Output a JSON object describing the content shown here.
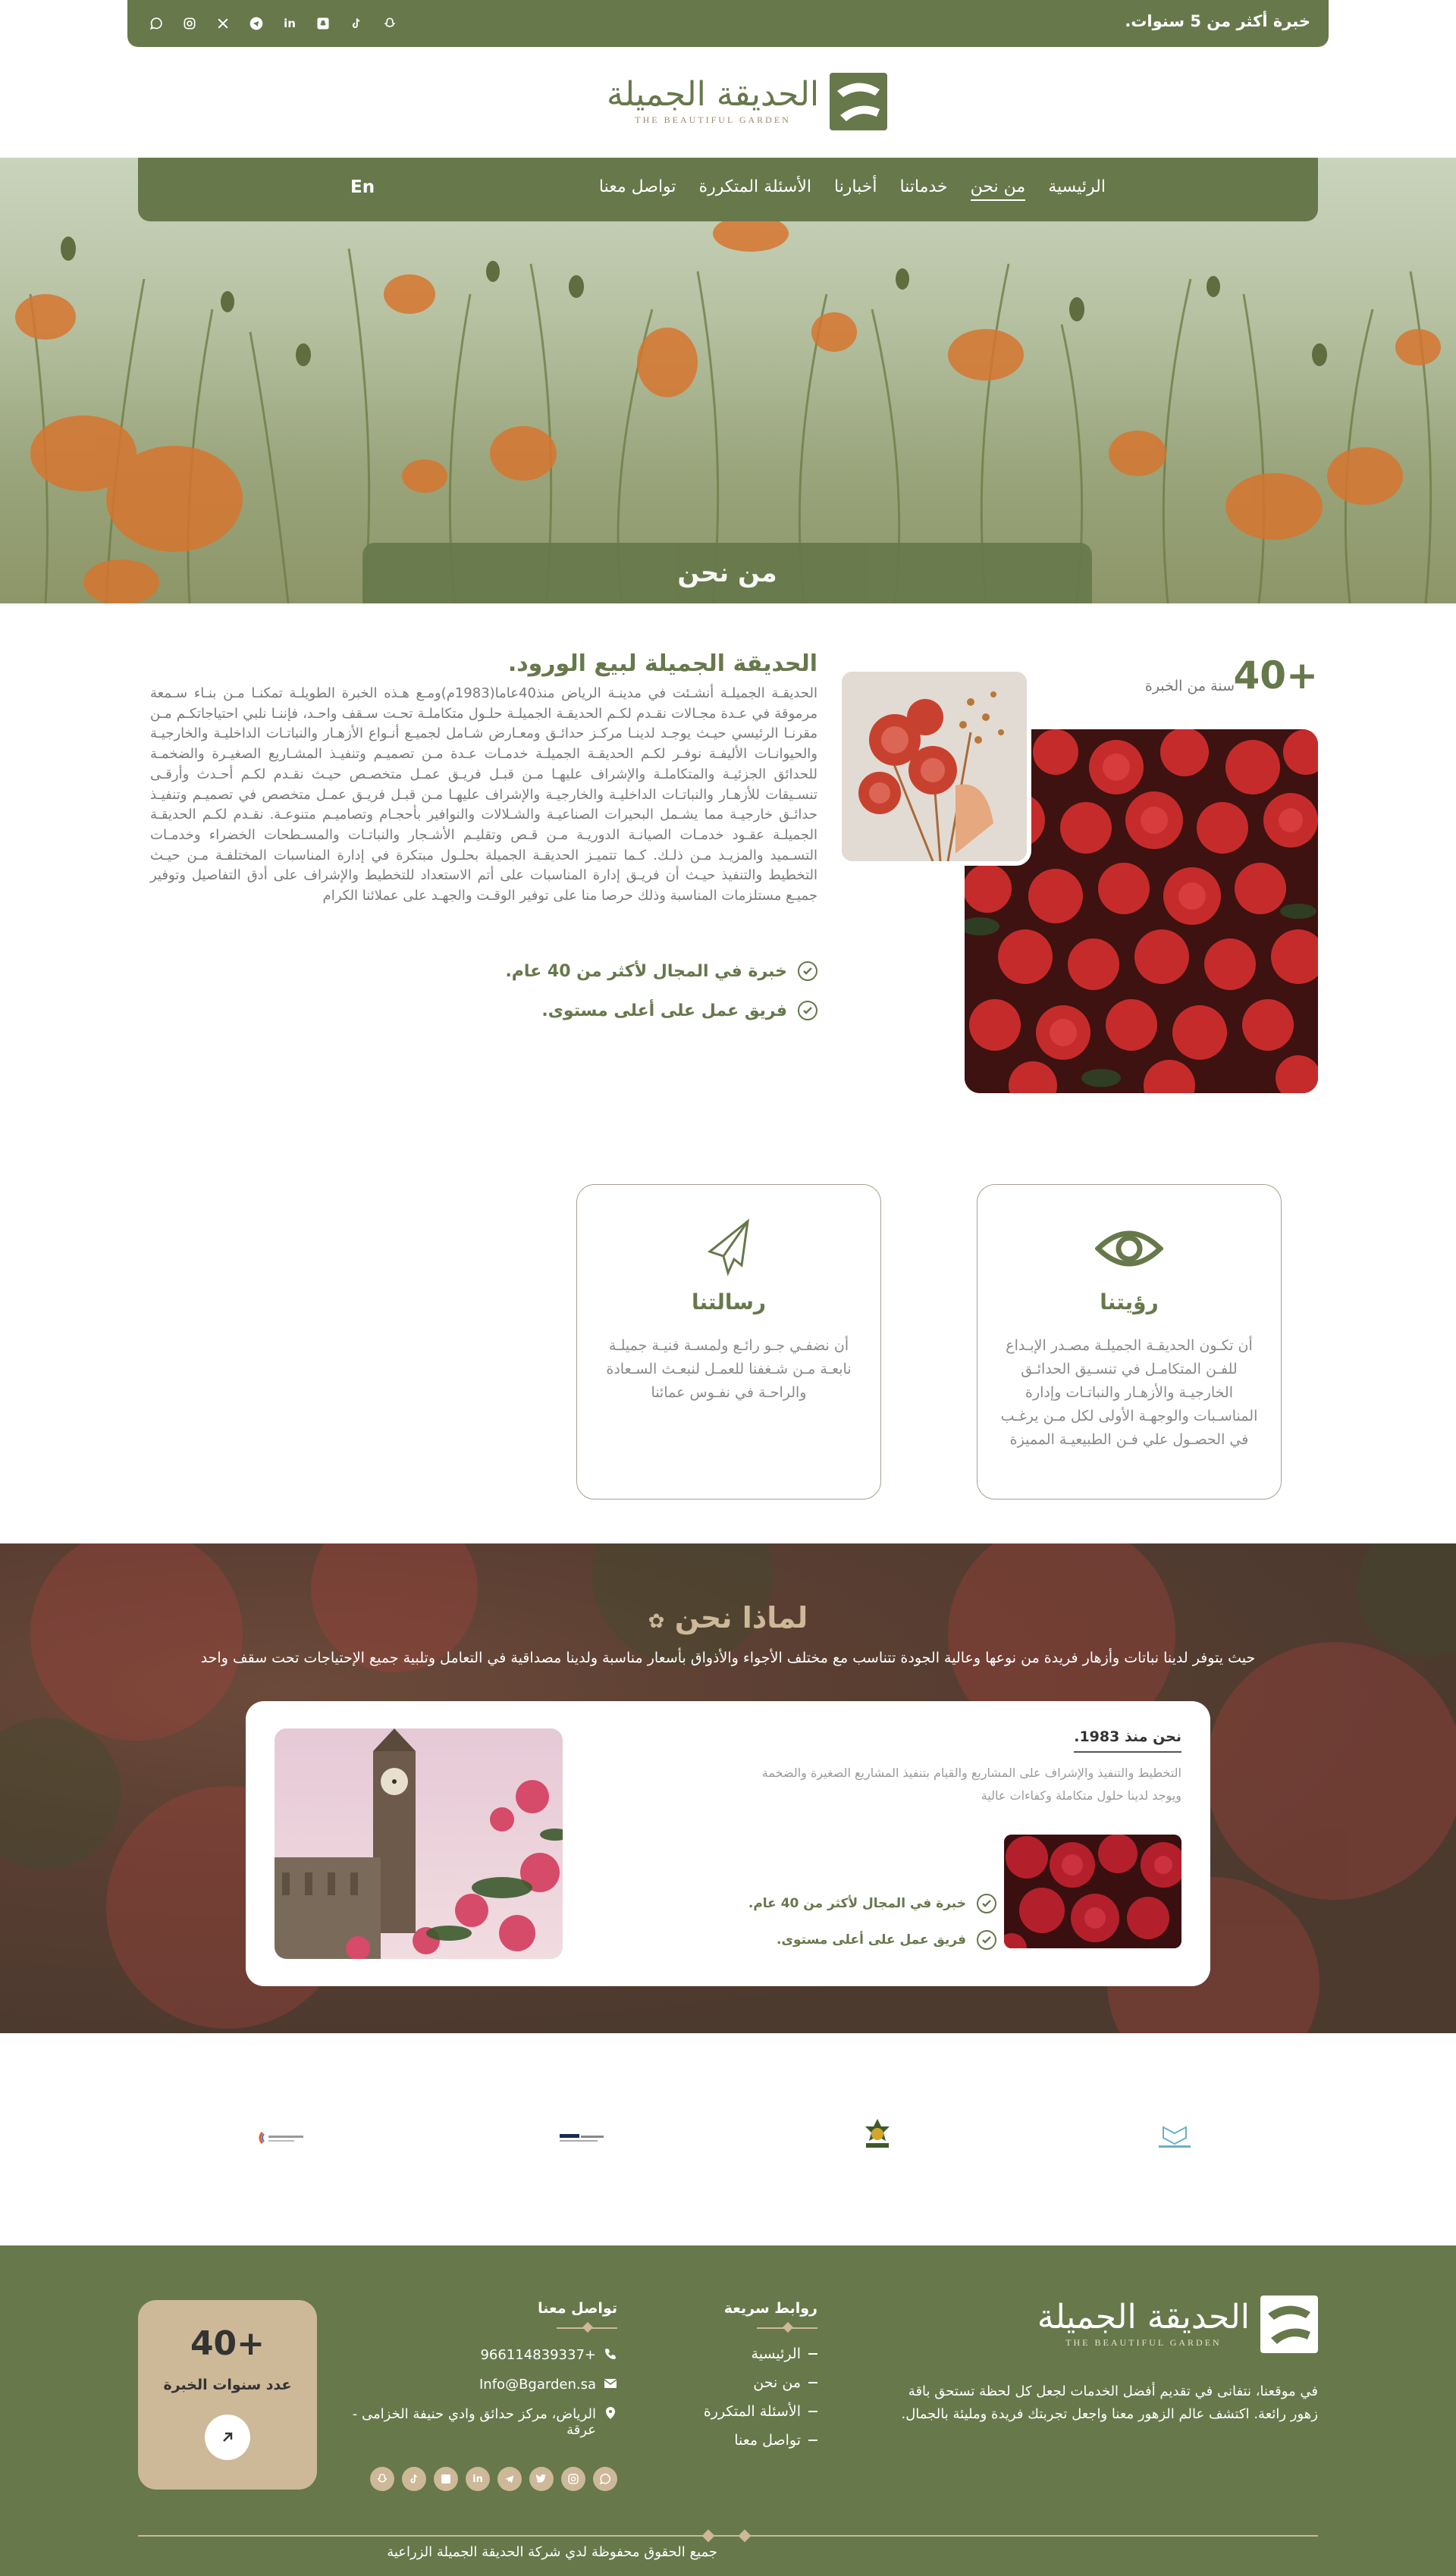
{
  "topbar": {
    "experience": "خبرة أكثر من 5 سنوات.",
    "socials": [
      "whatsapp-icon",
      "instagram-icon",
      "x-icon",
      "telegram-icon",
      "linkedin-icon",
      "snapchat-square-icon",
      "tiktok-icon",
      "snapchat-icon"
    ]
  },
  "brand": {
    "name_ar": "الحديقة الجميلة",
    "name_en": "THE BEAUTIFUL GARDEN",
    "color_primary": "#67784b",
    "color_accent": "#cdb898"
  },
  "nav": {
    "items": [
      "الرئيسية",
      "من نحن",
      "خدماتنا",
      "أخبارنا",
      "الأسئلة المتكررة",
      "تواصل معنا"
    ],
    "active": "من نحن",
    "lang": "En"
  },
  "hero": {
    "page_title": "من نحن"
  },
  "about": {
    "title": "الحديقة الجميلة لبيع الورود.",
    "body": "الحديقـة الجميلـة أنشـئت في مدينـة الرياض منذ40عاما(1983م)ومـع هـذه الخبرة الطويلـة تمكنـا مـن بنـاء سـمعة مرموقة في عـدة مجـالات نقـدم لكـم الحديقـة الجميلـة حلـول متكاملـة تحـت سـقف واحـد، فإننـا نلبي احتياجاتكـم مـن مقرنـا الرئيسي حيـث يوجـد لدينـا مركـز حدائـق ومعـارض شـامل لجميـع أنـواع الأزهـار والنباتـات الداخليـة والخارجيـة والحيوانـات الأليفـة نوفـر لكـم الحديقـة الجميلـة خدمـات عـدة مـن تصميـم وتنفيـذ المشـاريع الصغيـرة والضخمـة للحدائق الجزئيـة والمتكاملـة والإشراف عليهـا مـن قبـل فريـق عمـل متخصـص حيـث نقـدم لكـم أحـدث وأرقـى تنسـيقات للأزهـار والنباتـات الداخليـة والخارجيـة والإشراف عليهـا مـن قبـل فريـق عمـل متخصص في تصميـم وتنفيـذ حدائـق خارجيـة مما يشـمل البحيرات الصناعيـة والشـلالات والنوافير بأحجـام وتصاميـم متنوعـة. نقـدم لكـم الحديقـة الجميلـة عقـود خدمـات الصيانـة الدوريـة مـن قـص وتقليـم الأشـجار والنباتـات والمسـطحات الخضراء وخدمـات التسـميد والمزيـد مـن ذلـك. كـما تتميـز الحديقـة الجميلة بحلـول مبتكرة في إدارة المناسبات المختلفـة مـن حيـث التخطيط والتنفيذ حيـث أن فريـق إدارة المناسبات على أتم الاستعداد للتخطيط والإشراف على أدق التفاصيل وتوفير جميـع مستلزمات المناسبة وذلك حرصا منا على توفير الوقـت والجهـد على عملائنا الكرام",
    "checks": [
      "خبرة في المجال لأكثر من 40 عام.",
      "فريق عمل على أعلى مستوى."
    ],
    "years_number": "40+",
    "years_label": "سنة من الخبرة"
  },
  "vision": {
    "title": "رؤيتنا",
    "body": "أن تكـون الحديقـة الجميلـة مصـدر الإبـداع للفـن المتكامـل في تنسـيق الحدائـق الخارجيـة والأزهـار والنباتـات وإدارة المناسـبات والوجهـة الأولى لكل مـن يرغـب في الحصـول علي فـن الطبيعيـة المميزة"
  },
  "mission": {
    "title": "رسالتنا",
    "body": "أن نضفـي جـو رائـع ولمسـة فنيـة جميلـة نابعـة مـن شـغفنا للعمـل لنبعـث السـعادة والراحـة في نفـوس عمائنا"
  },
  "why": {
    "title": "لماذا نحن",
    "subtitle": "حيث يتوفر لدينا نباتات وأزهار فريدة من نوعها وعالية الجودة تتناسب مع مختلف الأجواء والأذواق بأسعار مناسبة ولدينا مصداقية في التعامل وتلبية جميع الإحتياجات تحت سقف واحد",
    "since": "نحن منذ 1983.",
    "text": "التخطيط والتنفيذ والإشراف على المشاريع والقيام بتنفيذ المشاريع الصغيرة والضخمة ويوجد لدينا حلول متكاملة وكفاءات عالية",
    "checks": [
      "خبرة في المجال لأكثر من 40 عام.",
      "فريق عمل على أعلى مستوى."
    ]
  },
  "footer": {
    "about": "في موقعنا، نتفانى في تقديم أفضل الخدمات لجعل كل لحظة تستحق باقة زهور رائعة. اكتشف عالم الزهور معنا واجعل تجربتك فريدة ومليئة بالجمال.",
    "quick_links_title": "روابط سريعة",
    "quick_links": [
      "الرئيسية",
      "من نحن",
      "الأسئلة المتكررة",
      "تواصل معنا"
    ],
    "contact_title": "تواصل معنا",
    "phone": "966114839337+",
    "email": "Info@Bgarden.sa",
    "address": "الرياض، مركز حدائق وادي حنيفة الخزامى - عرقة",
    "exp_number": "40+",
    "exp_label": "عدد سنوات الخبرة",
    "copyright": "جميع الحقوق محفوظة لدي شركة الحديقة الجميلة الزراعية"
  }
}
